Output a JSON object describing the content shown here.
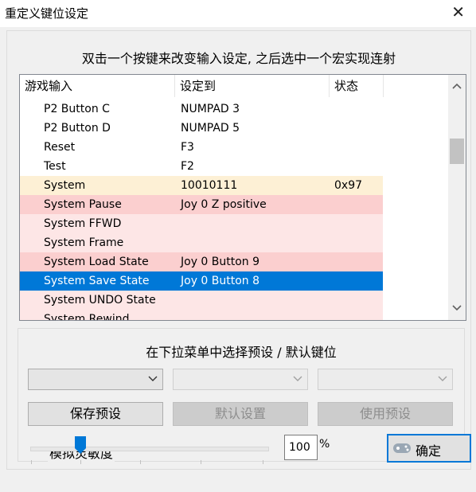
{
  "window": {
    "title": "重定义键位设定",
    "close_glyph": "✕"
  },
  "instruction": "双击一个按键来改变输入设定, 之后选中一个宏实现连射",
  "list": {
    "columns": [
      "游戏输入",
      "设定到",
      "状态"
    ],
    "rows": [
      {
        "input": "P2 Button C",
        "mapping": "NUMPAD 3",
        "status": "",
        "style": "white"
      },
      {
        "input": "P2 Button D",
        "mapping": "NUMPAD 5",
        "status": "",
        "style": "white"
      },
      {
        "input": "Reset",
        "mapping": "F3",
        "status": "",
        "style": "white"
      },
      {
        "input": "Test",
        "mapping": "F2",
        "status": "",
        "style": "white"
      },
      {
        "input": "System",
        "mapping": "10010111",
        "status": "0x97",
        "style": "cream"
      },
      {
        "input": "System Pause",
        "mapping": "Joy 0 Z positive",
        "status": "",
        "style": "pink"
      },
      {
        "input": "System FFWD",
        "mapping": "",
        "status": "",
        "style": "lightpink"
      },
      {
        "input": "System Frame",
        "mapping": "",
        "status": "",
        "style": "lightpink"
      },
      {
        "input": "System Load State",
        "mapping": "Joy 0 Button 9",
        "status": "",
        "style": "pink"
      },
      {
        "input": "System Save State",
        "mapping": "Joy 0 Button 8",
        "status": "",
        "style": "selected"
      },
      {
        "input": "System UNDO State",
        "mapping": "",
        "status": "",
        "style": "lightpink"
      },
      {
        "input": "System Rewind",
        "mapping": "",
        "status": "",
        "style": "lightpink"
      }
    ],
    "scrollbar": {
      "up_icon": "chevron-up",
      "down_icon": "chevron-down"
    }
  },
  "preset": {
    "title": "在下拉菜单中选择预设 / 默认键位",
    "dropdowns": [
      {
        "value": "",
        "enabled": true
      },
      {
        "value": "",
        "enabled": false
      },
      {
        "value": "",
        "enabled": false
      }
    ],
    "buttons": [
      {
        "label": "保存预设",
        "enabled": true
      },
      {
        "label": "默认设置",
        "enabled": false
      },
      {
        "label": "使用预设",
        "enabled": false
      }
    ]
  },
  "sensitivity": {
    "label": "模拟灵敏度",
    "value": "100",
    "unit": "%"
  },
  "ok_button": {
    "label": "确定"
  },
  "colors": {
    "selection": "#0078d7",
    "pink_row": "#fbcfcf",
    "lightpink_row": "#fde6e6",
    "cream_row": "#fdf0d5",
    "ok_border": "#0078d7"
  }
}
